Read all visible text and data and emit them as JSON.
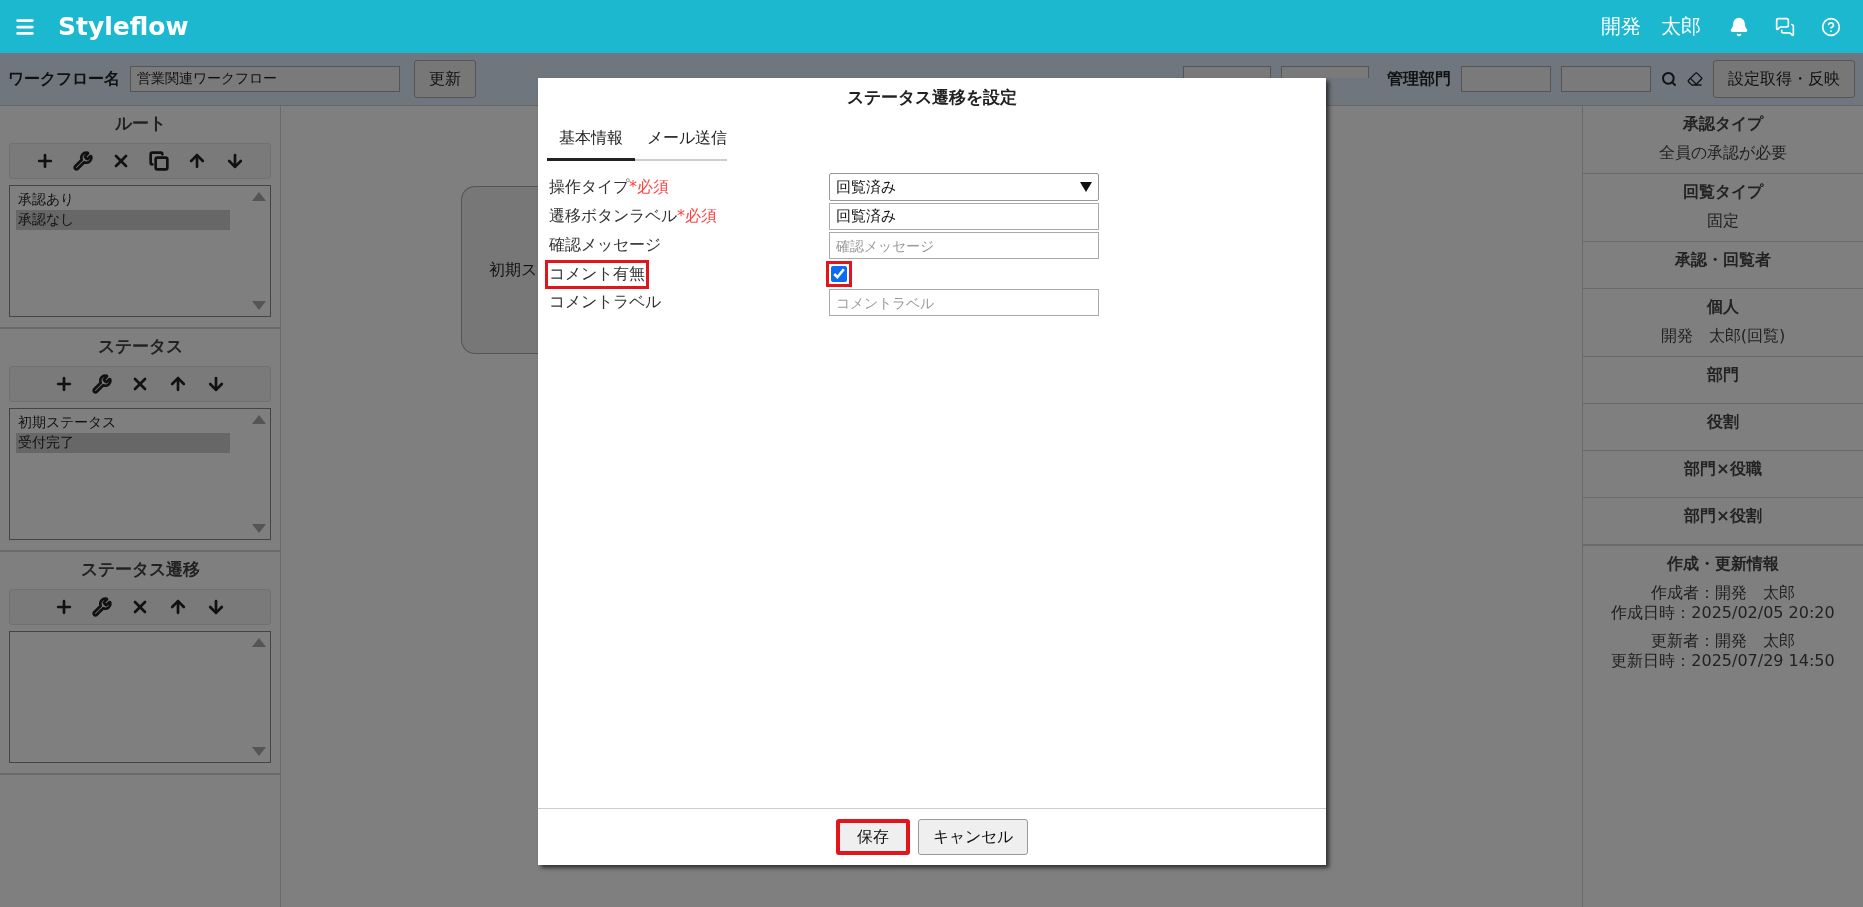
{
  "header": {
    "brand": "Styleflow",
    "user": "開発　太郎"
  },
  "toolbar": {
    "workflow_label": "ワークフロー名",
    "workflow_name": "営業関連ワークフロー",
    "update_button": "更新",
    "department_label": "管理部門",
    "apply_button": "設定取得・反映"
  },
  "left_sections": [
    {
      "title": "ルート",
      "tools": [
        {
          "kind": "plus"
        },
        {
          "kind": "wrench"
        },
        {
          "kind": "delete"
        },
        {
          "kind": "copy"
        },
        {
          "kind": "up"
        },
        {
          "kind": "down"
        }
      ],
      "items": [
        {
          "label": "承認あり",
          "selected": false
        },
        {
          "label": "承認なし",
          "selected": true
        }
      ]
    },
    {
      "title": "ステータス",
      "tools": [
        {
          "kind": "plus"
        },
        {
          "kind": "wrench"
        },
        {
          "kind": "delete"
        },
        {
          "kind": "up"
        },
        {
          "kind": "down"
        }
      ],
      "items": [
        {
          "label": "初期ステータス",
          "selected": false
        },
        {
          "label": "受付完了",
          "selected": true
        }
      ]
    },
    {
      "title": "ステータス遷移",
      "tools": [
        {
          "kind": "plus"
        },
        {
          "kind": "wrench"
        },
        {
          "kind": "delete"
        },
        {
          "kind": "up"
        },
        {
          "kind": "down"
        }
      ]
    }
  ],
  "canvas": {
    "nodes": [
      {
        "label": "初期ス"
      }
    ]
  },
  "modal": {
    "title": "ステータス遷移を設定",
    "tabs": [
      {
        "label": "基本情報",
        "selected": true
      },
      {
        "label": "メール送信",
        "selected": false
      }
    ],
    "fields": [
      {
        "kind": "select",
        "label": "操作タイプ",
        "required_mark": "*必須",
        "value": "回覧済み",
        "highlighted": false
      },
      {
        "kind": "text",
        "label": "遷移ボタンラベル",
        "required_mark": "*必須",
        "value": "回覧済み",
        "highlighted": false
      },
      {
        "kind": "text",
        "label": "確認メッセージ",
        "placeholder": "確認メッセージ",
        "highlighted": false
      },
      {
        "kind": "checkbox",
        "label": "コメント有無",
        "checked": true,
        "highlighted": true
      },
      {
        "kind": "text",
        "label": "コメントラベル",
        "placeholder": "コメントラベル",
        "highlighted": false
      }
    ],
    "buttons": [
      {
        "label": "保存",
        "highlighted": true
      },
      {
        "label": "キャンセル",
        "highlighted": false
      }
    ]
  },
  "right_panel": {
    "sections": [
      {
        "title": "承認タイプ",
        "groups": [
          [
            "全員の承認が必要"
          ]
        ]
      },
      {
        "title": "回覧タイプ",
        "groups": [
          [
            "固定"
          ]
        ]
      },
      {
        "title": "承認・回覧者"
      },
      {
        "title": "個人",
        "groups": [
          [
            "開発　太郎(回覧)"
          ]
        ]
      },
      {
        "title": "部門"
      },
      {
        "title": "役割"
      },
      {
        "title": "部門×役職"
      },
      {
        "title": "部門×役割"
      },
      {
        "title": "作成・更新情報",
        "groups": [
          [
            "作成者：開発　太郎",
            "作成日時：2025/02/05 20:20"
          ],
          [
            "更新者：開発　太郎",
            "更新日時：2025/07/29 14:50"
          ]
        ]
      }
    ]
  }
}
